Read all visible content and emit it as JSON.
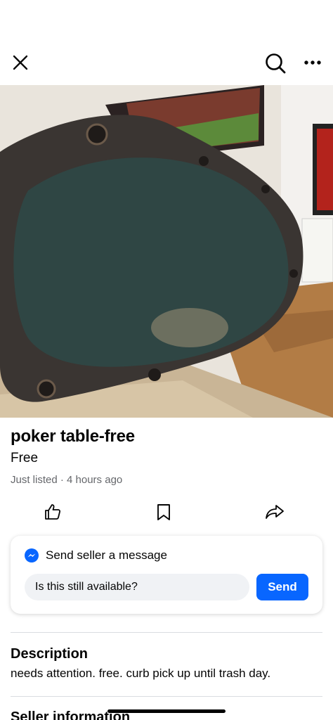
{
  "header": {
    "close_icon": "close-icon",
    "search_icon": "search-icon",
    "more_icon": "more-icon"
  },
  "listing": {
    "title": "poker table-free",
    "price": "Free",
    "meta": "Just listed · 4 hours ago",
    "photo_alt": "poker table photo"
  },
  "actions": {
    "like_icon": "thumbs-up-icon",
    "save_icon": "bookmark-icon",
    "share_icon": "share-icon"
  },
  "message": {
    "heading": "Send seller a message",
    "input_value": "Is this still available?",
    "send_label": "Send",
    "messenger_icon": "messenger-icon"
  },
  "description": {
    "heading": "Description",
    "text": "needs attention. free. curb pick up until trash day."
  },
  "seller": {
    "heading": "Seller information"
  },
  "colors": {
    "accent": "#0866ff",
    "secondary_text": "#65676b",
    "input_bg": "#f0f2f5"
  }
}
